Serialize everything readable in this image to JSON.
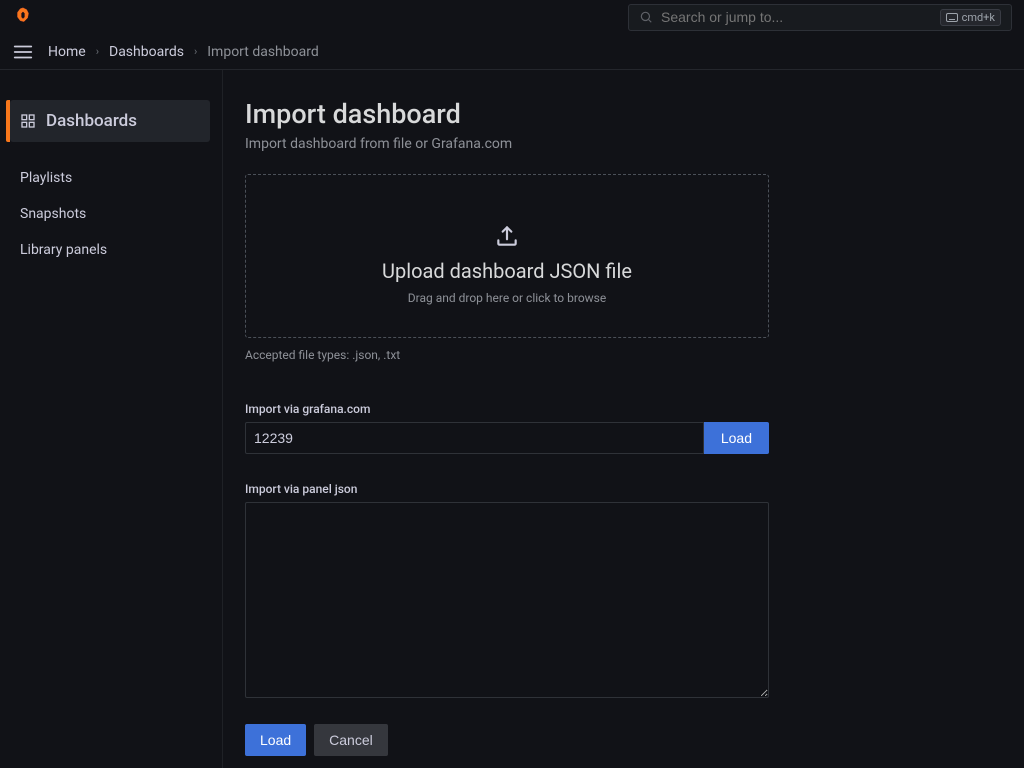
{
  "topbar": {
    "search_placeholder": "Search or jump to...",
    "shortcut": "cmd+k"
  },
  "breadcrumb": {
    "home": "Home",
    "dashboards": "Dashboards",
    "current": "Import dashboard"
  },
  "sidebar": {
    "dashboards": "Dashboards",
    "playlists": "Playlists",
    "snapshots": "Snapshots",
    "library_panels": "Library panels"
  },
  "page": {
    "title": "Import dashboard",
    "subtitle": "Import dashboard from file or Grafana.com"
  },
  "dropzone": {
    "title": "Upload dashboard JSON file",
    "subtitle": "Drag and drop here or click to browse"
  },
  "accepted_types": "Accepted file types: .json, .txt",
  "grafana_import": {
    "label": "Import via grafana.com",
    "value": "12239",
    "load_btn": "Load"
  },
  "json_import": {
    "label": "Import via panel json",
    "value": ""
  },
  "actions": {
    "load": "Load",
    "cancel": "Cancel"
  }
}
